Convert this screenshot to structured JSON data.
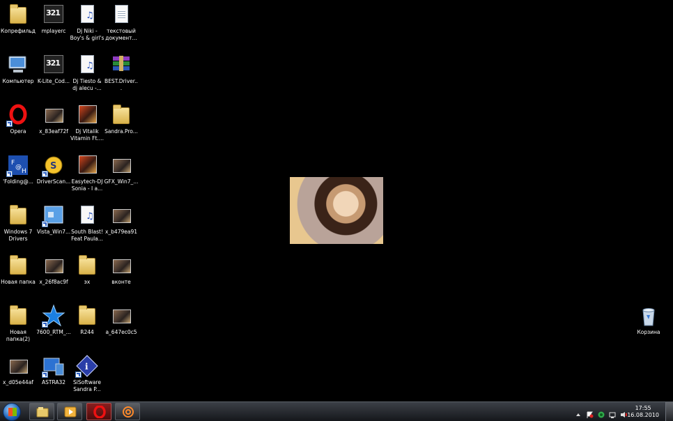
{
  "desktop": {
    "icons": [
      {
        "label": "Копрефильд",
        "icon": "folder-icon"
      },
      {
        "label": "mplayerc",
        "icon": "media-player-classic-icon"
      },
      {
        "label": "Dj Niki - Boy's & girl's",
        "icon": "audio-file-icon"
      },
      {
        "label": "текстовый документ...",
        "icon": "text-document-icon"
      },
      {
        "label": "Компьютер",
        "icon": "computer-icon"
      },
      {
        "label": "K-Lite_Cod...",
        "icon": "media-player-classic-icon"
      },
      {
        "label": "Dj Tiesto & dj alecu -...",
        "icon": "audio-file-icon"
      },
      {
        "label": "BEST.Driver...",
        "icon": "winrar-archive-icon"
      },
      {
        "label": "Opera",
        "icon": "opera-icon"
      },
      {
        "label": "x_83eaf72f",
        "icon": "image-file-icon"
      },
      {
        "label": "Dj Vitalik Vitamin Ft....",
        "icon": "audio-album-icon"
      },
      {
        "label": "Sandra.Pro...",
        "icon": "folder-icon"
      },
      {
        "label": "'Folding@...",
        "icon": "folding-at-home-icon"
      },
      {
        "label": "DriverScan...",
        "icon": "driverscanner-icon"
      },
      {
        "label": "Easytech-DJ Sonia - I a...",
        "icon": "audio-album-icon"
      },
      {
        "label": "GFX_Win7_...",
        "icon": "image-file-icon"
      },
      {
        "label": "Windows 7 Drivers",
        "icon": "folder-icon"
      },
      {
        "label": "Vista_Win7...",
        "icon": "vista-window-icon"
      },
      {
        "label": "South Blast! Feat Paula...",
        "icon": "audio-file-icon"
      },
      {
        "label": "x_b479ea91",
        "icon": "image-file-icon"
      },
      {
        "label": "Новая папка",
        "icon": "folder-icon"
      },
      {
        "label": "x_26f8ac9f",
        "icon": "image-file-icon"
      },
      {
        "label": "эх",
        "icon": "folder-icon"
      },
      {
        "label": "вконте",
        "icon": "image-file-icon"
      },
      {
        "label": "Новая папка(2)",
        "icon": "folder-icon"
      },
      {
        "label": "7600_RTM_...",
        "icon": "star-logo-icon"
      },
      {
        "label": "R244",
        "icon": "folder-icon"
      },
      {
        "label": "a_647ec0c5",
        "icon": "image-file-icon"
      },
      {
        "label": "x_d05e44af",
        "icon": "image-file-icon"
      },
      {
        "label": "ASTRA32",
        "icon": "astra32-icon"
      },
      {
        "label": "SiSoftware Sandra P...",
        "icon": "sisoftware-sandra-icon"
      }
    ],
    "recycle_bin": {
      "label": "Корзина",
      "icon": "recycle-bin-icon"
    },
    "wallpaper": {
      "icon": "wallpaper-photo-icon"
    }
  },
  "taskbar": {
    "start": {
      "icon": "windows-start-icon"
    },
    "buttons": [
      {
        "icon": "windows-explorer-icon",
        "active": false
      },
      {
        "icon": "windows-media-player-icon",
        "active": false
      },
      {
        "icon": "opera-icon",
        "active": true
      },
      {
        "icon": "at-sign-mail-icon",
        "active": false
      }
    ],
    "tray": [
      "show-hidden-icons-arrow-icon",
      "action-center-flag-icon",
      "network-icon",
      "volume-icon",
      "power-icon"
    ],
    "clock": {
      "time": "17:55",
      "date": "16.08.2010"
    }
  },
  "colors": {
    "desktop_bg": "#000000",
    "taskbar_top": "#3c4047",
    "taskbar_bottom": "#15171b",
    "opera_red": "#d50e0e"
  }
}
